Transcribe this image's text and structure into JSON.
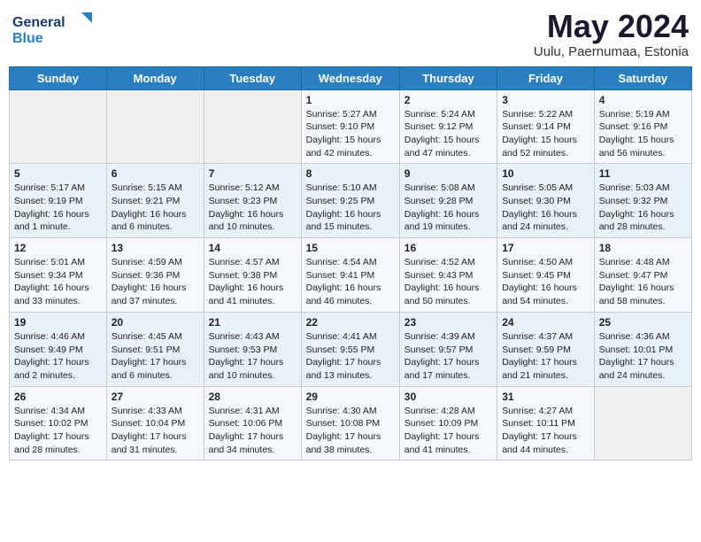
{
  "logo": {
    "line1": "General",
    "line2": "Blue"
  },
  "title": "May 2024",
  "location": "Uulu, Paernumaa, Estonia",
  "days_header": [
    "Sunday",
    "Monday",
    "Tuesday",
    "Wednesday",
    "Thursday",
    "Friday",
    "Saturday"
  ],
  "weeks": [
    [
      {
        "day": "",
        "info": ""
      },
      {
        "day": "",
        "info": ""
      },
      {
        "day": "",
        "info": ""
      },
      {
        "day": "1",
        "info": "Sunrise: 5:27 AM\nSunset: 9:10 PM\nDaylight: 15 hours\nand 42 minutes."
      },
      {
        "day": "2",
        "info": "Sunrise: 5:24 AM\nSunset: 9:12 PM\nDaylight: 15 hours\nand 47 minutes."
      },
      {
        "day": "3",
        "info": "Sunrise: 5:22 AM\nSunset: 9:14 PM\nDaylight: 15 hours\nand 52 minutes."
      },
      {
        "day": "4",
        "info": "Sunrise: 5:19 AM\nSunset: 9:16 PM\nDaylight: 15 hours\nand 56 minutes."
      }
    ],
    [
      {
        "day": "5",
        "info": "Sunrise: 5:17 AM\nSunset: 9:19 PM\nDaylight: 16 hours\nand 1 minute."
      },
      {
        "day": "6",
        "info": "Sunrise: 5:15 AM\nSunset: 9:21 PM\nDaylight: 16 hours\nand 6 minutes."
      },
      {
        "day": "7",
        "info": "Sunrise: 5:12 AM\nSunset: 9:23 PM\nDaylight: 16 hours\nand 10 minutes."
      },
      {
        "day": "8",
        "info": "Sunrise: 5:10 AM\nSunset: 9:25 PM\nDaylight: 16 hours\nand 15 minutes."
      },
      {
        "day": "9",
        "info": "Sunrise: 5:08 AM\nSunset: 9:28 PM\nDaylight: 16 hours\nand 19 minutes."
      },
      {
        "day": "10",
        "info": "Sunrise: 5:05 AM\nSunset: 9:30 PM\nDaylight: 16 hours\nand 24 minutes."
      },
      {
        "day": "11",
        "info": "Sunrise: 5:03 AM\nSunset: 9:32 PM\nDaylight: 16 hours\nand 28 minutes."
      }
    ],
    [
      {
        "day": "12",
        "info": "Sunrise: 5:01 AM\nSunset: 9:34 PM\nDaylight: 16 hours\nand 33 minutes."
      },
      {
        "day": "13",
        "info": "Sunrise: 4:59 AM\nSunset: 9:36 PM\nDaylight: 16 hours\nand 37 minutes."
      },
      {
        "day": "14",
        "info": "Sunrise: 4:57 AM\nSunset: 9:38 PM\nDaylight: 16 hours\nand 41 minutes."
      },
      {
        "day": "15",
        "info": "Sunrise: 4:54 AM\nSunset: 9:41 PM\nDaylight: 16 hours\nand 46 minutes."
      },
      {
        "day": "16",
        "info": "Sunrise: 4:52 AM\nSunset: 9:43 PM\nDaylight: 16 hours\nand 50 minutes."
      },
      {
        "day": "17",
        "info": "Sunrise: 4:50 AM\nSunset: 9:45 PM\nDaylight: 16 hours\nand 54 minutes."
      },
      {
        "day": "18",
        "info": "Sunrise: 4:48 AM\nSunset: 9:47 PM\nDaylight: 16 hours\nand 58 minutes."
      }
    ],
    [
      {
        "day": "19",
        "info": "Sunrise: 4:46 AM\nSunset: 9:49 PM\nDaylight: 17 hours\nand 2 minutes."
      },
      {
        "day": "20",
        "info": "Sunrise: 4:45 AM\nSunset: 9:51 PM\nDaylight: 17 hours\nand 6 minutes."
      },
      {
        "day": "21",
        "info": "Sunrise: 4:43 AM\nSunset: 9:53 PM\nDaylight: 17 hours\nand 10 minutes."
      },
      {
        "day": "22",
        "info": "Sunrise: 4:41 AM\nSunset: 9:55 PM\nDaylight: 17 hours\nand 13 minutes."
      },
      {
        "day": "23",
        "info": "Sunrise: 4:39 AM\nSunset: 9:57 PM\nDaylight: 17 hours\nand 17 minutes."
      },
      {
        "day": "24",
        "info": "Sunrise: 4:37 AM\nSunset: 9:59 PM\nDaylight: 17 hours\nand 21 minutes."
      },
      {
        "day": "25",
        "info": "Sunrise: 4:36 AM\nSunset: 10:01 PM\nDaylight: 17 hours\nand 24 minutes."
      }
    ],
    [
      {
        "day": "26",
        "info": "Sunrise: 4:34 AM\nSunset: 10:02 PM\nDaylight: 17 hours\nand 28 minutes."
      },
      {
        "day": "27",
        "info": "Sunrise: 4:33 AM\nSunset: 10:04 PM\nDaylight: 17 hours\nand 31 minutes."
      },
      {
        "day": "28",
        "info": "Sunrise: 4:31 AM\nSunset: 10:06 PM\nDaylight: 17 hours\nand 34 minutes."
      },
      {
        "day": "29",
        "info": "Sunrise: 4:30 AM\nSunset: 10:08 PM\nDaylight: 17 hours\nand 38 minutes."
      },
      {
        "day": "30",
        "info": "Sunrise: 4:28 AM\nSunset: 10:09 PM\nDaylight: 17 hours\nand 41 minutes."
      },
      {
        "day": "31",
        "info": "Sunrise: 4:27 AM\nSunset: 10:11 PM\nDaylight: 17 hours\nand 44 minutes."
      },
      {
        "day": "",
        "info": ""
      }
    ]
  ]
}
